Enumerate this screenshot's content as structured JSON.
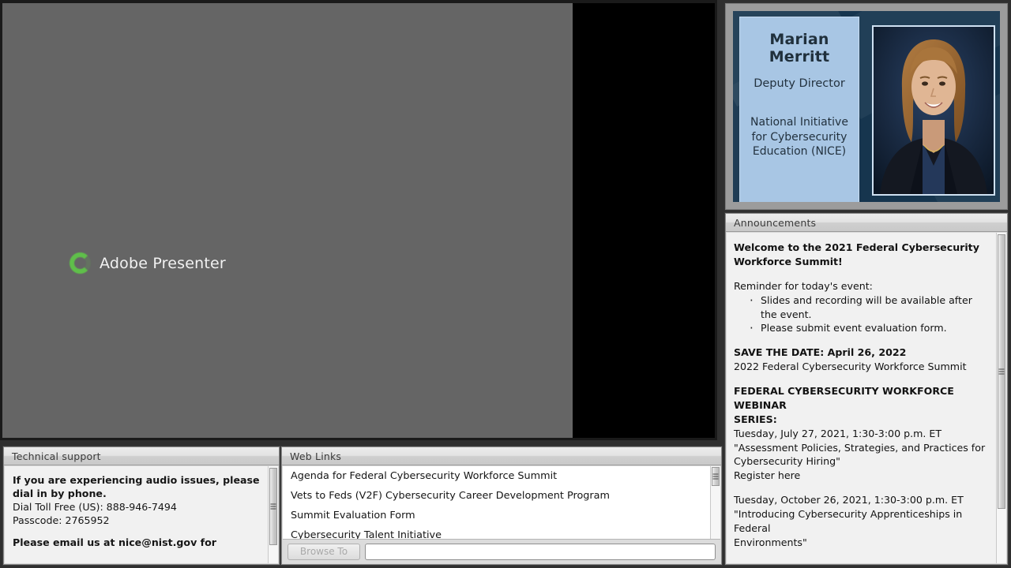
{
  "main_share": {
    "loader_label": "Adobe Presenter",
    "spinner_icon": "loading-spinner-icon",
    "spinner_color": "#5fbf4a",
    "background_color": "#656565"
  },
  "slide": {
    "presenter_name_line1": "Marian",
    "presenter_name_line2": "Merritt",
    "presenter_title": "Deputy Director",
    "org_line1": "National Initiative",
    "org_line2": "for Cybersecurity",
    "org_line3": "Education (NICE)",
    "photo_alt": "presenter-headshot",
    "card_color": "#a8c6e4",
    "background_color": "#16354e"
  },
  "announcements": {
    "title": "Announcements",
    "welcome": "Welcome to the 2021 Federal Cybersecurity Workforce Summit!",
    "reminder_heading": "Reminder for today's event:",
    "reminder_items": [
      "Slides and recording will be available after the event.",
      "Please submit event evaluation form."
    ],
    "save_the_date": "SAVE THE DATE: April 26, 2022",
    "save_the_date_sub": "2022 Federal Cybersecurity Workforce Summit",
    "webinar_series_heading_line1": "FEDERAL CYBERSECURITY WORKFORCE WEBINAR",
    "webinar_series_heading_line2": "SERIES:",
    "webinar1_date": "Tuesday, July 27, 2021, 1:30-3:00 p.m. ET",
    "webinar1_title_line1": "\"Assessment Policies, Strategies, and Practices for",
    "webinar1_title_line2": "Cybersecurity Hiring\"",
    "webinar1_register": "Register here",
    "webinar2_date": "Tuesday, October 26, 2021, 1:30-3:00 p.m. ET",
    "webinar2_title_line1": "\"Introducing Cybersecurity Apprenticeships in Federal",
    "webinar2_title_line2": "Environments\""
  },
  "technical_support": {
    "title": "Technical support",
    "line1": "If you are experiencing audio issues, please dial in by phone.",
    "line2": "Dial Toll Free (US): 888-946-7494",
    "line3": "Passcode: 2765952",
    "line4": "Please email us at nice@nist.gov for"
  },
  "web_links": {
    "title": "Web Links",
    "items": [
      "Agenda for Federal Cybersecurity Workforce Summit",
      "Vets to Feds (V2F) Cybersecurity Career Development Program",
      "Summit Evaluation Form",
      "Cybersecurity Talent Initiative"
    ],
    "browse_button_label": "Browse To",
    "url_value": "",
    "url_placeholder": ""
  }
}
